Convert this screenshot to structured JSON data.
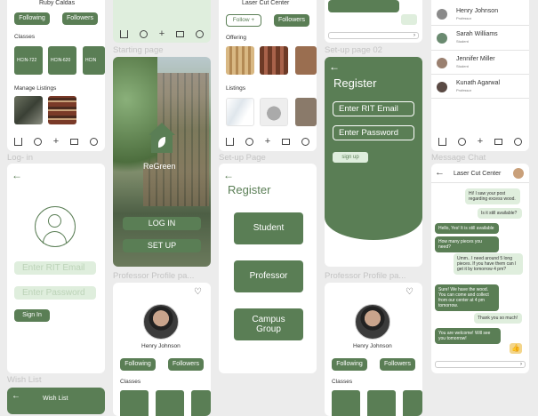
{
  "col1": {
    "top_card": {
      "name": "Ruby Caldas",
      "following": "Following",
      "followers": "Followers",
      "classes_title": "Classes",
      "classes": [
        "HCIN-722",
        "HCIN-620",
        "HCIN"
      ],
      "listings_title": "Manage Listings"
    },
    "login_label": "Log- in",
    "login": {
      "email_placeholder": "Enter RIT Email",
      "password_placeholder": "Enter Password",
      "signin": "Sign In"
    },
    "wishlist_label": "Wish List",
    "wishlist_title": "Wish List"
  },
  "col2": {
    "starting_label": "Starting page",
    "brand": "ReGreen",
    "login": "LOG IN",
    "setup": "SET UP",
    "professor_label": "Professor Profile pa...",
    "profile": {
      "name": "Henry Johnson",
      "following": "Following",
      "followers": "Followers",
      "classes_title": "Classes"
    }
  },
  "col3": {
    "top": {
      "title": "Laser Cut Center",
      "follow": "Follow +",
      "followers": "Followers",
      "offering": "Offering",
      "listings": "Listings"
    },
    "setup_label": "Set-up Page",
    "register_title": "Register",
    "roles": [
      "Student",
      "Professor",
      "Campus Group"
    ]
  },
  "col4": {
    "setup02_label": "Set-up page 02",
    "register_title": "Register",
    "email_placeholder": "Enter RIT Email",
    "password_placeholder": "Enter Password",
    "signup": "sign up",
    "professor_label": "Professor Profile pa...",
    "profile": {
      "name": "Henry Johnson",
      "following": "Following",
      "followers": "Followers",
      "classes_title": "Classes"
    }
  },
  "col5": {
    "contacts": [
      {
        "name": "Henry Johnson",
        "role": "Professor"
      },
      {
        "name": "Sarah Williams",
        "role": "Student"
      },
      {
        "name": "Jennifer Miller",
        "role": "Student"
      },
      {
        "name": "Kunath Agarwal",
        "role": "Professor"
      }
    ],
    "message_label": "Message Chat",
    "chat_title": "Laser Cut Center",
    "messages": [
      {
        "side": "out",
        "text": "Hi! I saw your post regarding excess wood."
      },
      {
        "side": "out",
        "text": "Is it still available?"
      },
      {
        "side": "in",
        "text": "Hello, Yes! It is still available"
      },
      {
        "side": "in",
        "text": "How many pieces you need?"
      },
      {
        "side": "out",
        "text": "Umm.. I need around 5 long pieces. If you have them can I get it by tomorrow 4 pm?"
      },
      {
        "side": "in",
        "text": "Sure! We have the wood. You can come and collect from our center at 4 pm tomorrow."
      },
      {
        "side": "out",
        "text": "Thank you so much!"
      },
      {
        "side": "in",
        "text": "You are welcome! Will see you tomorrow!"
      }
    ]
  },
  "colors": {
    "green": "#5a7e55",
    "light_green": "#dfeedd",
    "bg": "#ececec"
  }
}
